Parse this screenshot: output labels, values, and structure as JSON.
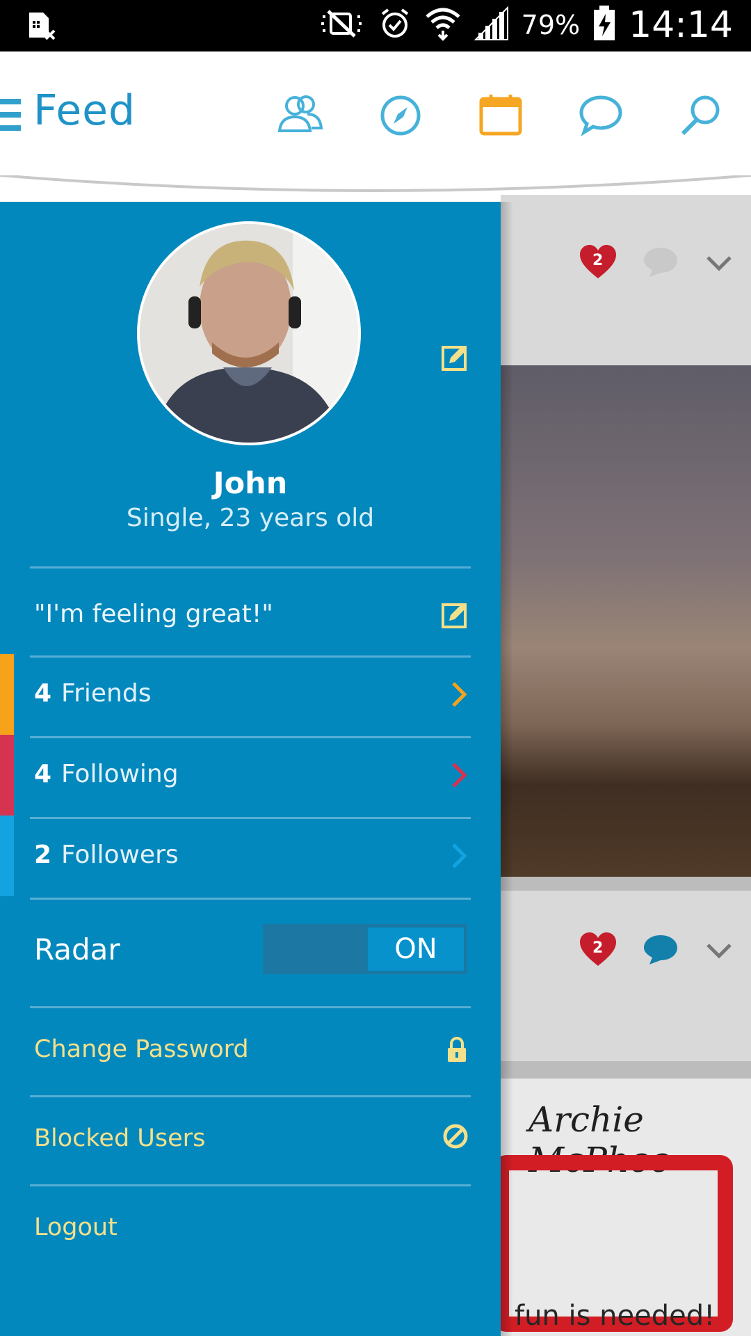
{
  "status_bar": {
    "battery": "79%",
    "time": "14:14",
    "icons": [
      "sim-missing-icon",
      "mute-icon",
      "alarm-icon",
      "wifi-icon",
      "signal-icon",
      "battery-charging-icon"
    ]
  },
  "app_bar": {
    "title": "Feed",
    "icons": [
      "people-icon",
      "compass-icon",
      "calendar-icon",
      "chat-icon",
      "search-icon"
    ],
    "active_icon_color": "#f5a623",
    "icon_color": "#46b2d9"
  },
  "profile": {
    "name": "John",
    "subtitle": "Single, 23 years old",
    "status": "\"I'm feeling great!\""
  },
  "stats": [
    {
      "count": "4",
      "label": "Friends",
      "color": "#f7a21b"
    },
    {
      "count": "4",
      "label": "Following",
      "color": "#d63351"
    },
    {
      "count": "2",
      "label": "Followers",
      "color": "#13a3e0"
    }
  ],
  "radar": {
    "label": "Radar",
    "state": "ON"
  },
  "menu": {
    "change_password": "Change Password",
    "blocked_users": "Blocked Users",
    "logout": "Logout"
  },
  "feed": {
    "card_a_likes": "2",
    "card_b_likes": "2",
    "card_b_brand": "Archie McPhee",
    "card_b_caption": "fun is needed!"
  },
  "colors": {
    "drawer": "#0388bd",
    "accent_yellow": "#f3e08a"
  }
}
